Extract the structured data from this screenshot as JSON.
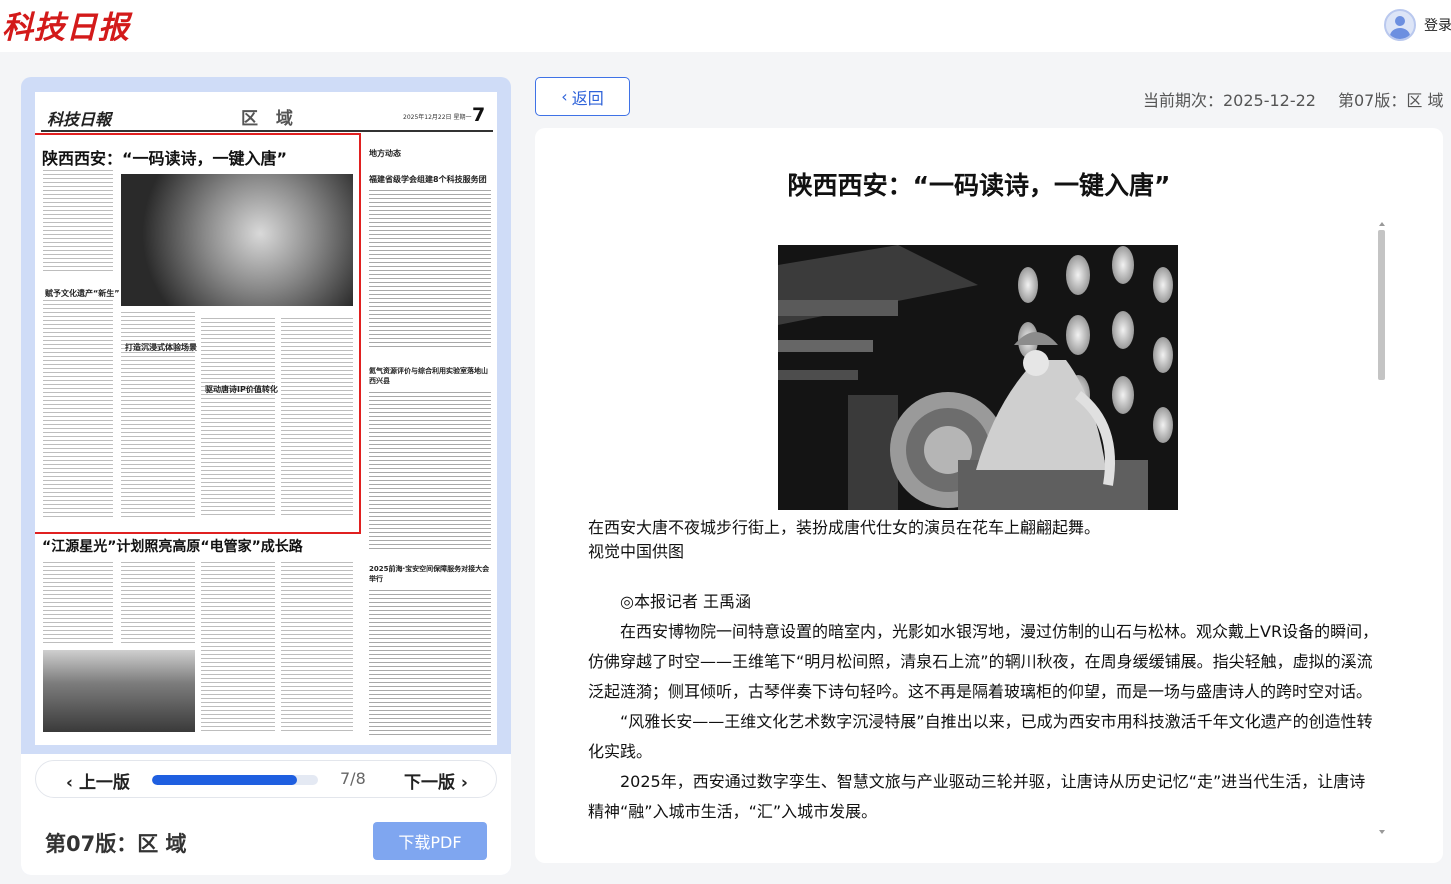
{
  "header": {
    "logo_text": "科技日报",
    "login_label": "登录"
  },
  "newspaper": {
    "masthead": "科技日報",
    "section": "区 域",
    "date_line": "2025年12月22日 星期一",
    "page_number": "7",
    "headline_main": "陕西西安：“一码读诗，一键入唐”",
    "headline_second": "“江源星光”计划照亮高原“电管家”成长路",
    "side_heading_1": "地方动态",
    "side_heading_2": "福建省级学会组建8个科技服务团",
    "side_heading_3": "氦气资源评价与综合利用实验室落地山西兴县",
    "side_heading_4": "2025前海·宝安空间保障服务对接大会举行",
    "sub_1": "赋予文化遗产“新生”",
    "sub_2": "打造沉浸式体验场景",
    "sub_3": "驱动唐诗IP价值转化"
  },
  "pager": {
    "prev_label": "上一版",
    "next_label": "下一版",
    "current": 7,
    "total": 8,
    "count_text": "7/8",
    "progress_fraction": 0.875
  },
  "edition_label": "第07版：区 域",
  "download_label": "下载PDF",
  "back_label": "返回",
  "issue_info": {
    "date_text": "当前期次：2025-12-22",
    "edition_text": "第07版：区 域"
  },
  "article": {
    "title": "陕西西安：“一码读诗，一键入唐”",
    "caption_line1": "在西安大唐不夜城步行街上，装扮成唐代仕女的演员在花车上翩翩起舞。",
    "caption_line2": "视觉中国供图",
    "byline": "◎本报记者 王禹涵",
    "paragraphs": [
      "在西安博物院一间特意设置的暗室内，光影如水银泻地，漫过仿制的山石与松林。观众戴上VR设备的瞬间，仿佛穿越了时空——王维笔下“明月松间照，清泉石上流”的辋川秋夜，在周身缓缓铺展。指尖轻触，虚拟的溪流泛起涟漪；侧耳倾听，古琴伴奏下诗句轻吟。这不再是隔着玻璃柜的仰望，而是一场与盛唐诗人的跨时空对话。",
      "“风雅长安——王维文化艺术数字沉浸特展”自推出以来，已成为西安市用科技激活千年文化遗产的创造性转化实践。",
      "2025年，西安通过数字孪生、智慧文旅与产业驱动三轮并驱，让唐诗从历史记忆“走”进当代生活，让唐诗精神“融”入城市生活，“汇”入城市发展。"
    ]
  },
  "colors": {
    "accent": "#1f5fe0",
    "button_blue": "#3f72e6",
    "pdf_button": "#7fa6f0",
    "logo_red": "#d31a1a",
    "panel_blue": "#cfdcf7"
  }
}
